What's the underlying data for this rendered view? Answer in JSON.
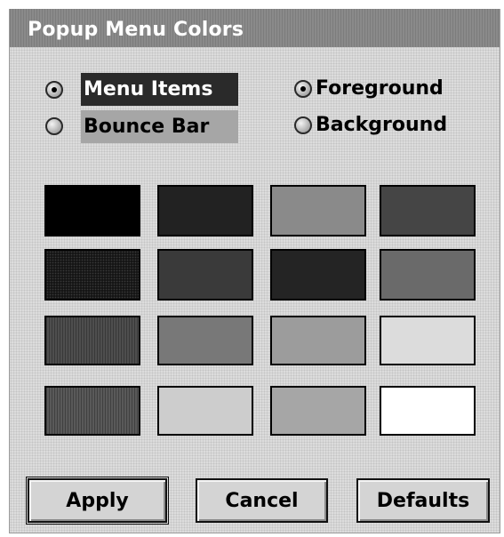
{
  "window": {
    "title": "Popup Menu Colors"
  },
  "target": {
    "items": [
      {
        "label": "Menu Items",
        "checked": true
      },
      {
        "label": "Bounce Bar",
        "checked": false
      }
    ]
  },
  "layer": {
    "items": [
      {
        "label": "Foreground",
        "checked": true
      },
      {
        "label": "Background",
        "checked": false
      }
    ]
  },
  "palette": {
    "colors": [
      "#000000",
      "#222222",
      "#8a8a8a",
      "#454545",
      "#151515",
      "#3a3a3a",
      "#242424",
      "#6a6a6a",
      "#4e4e4e",
      "#787878",
      "#9c9c9c",
      "#dcdcdc",
      "#595959",
      "#cdcdcd",
      "#a6a6a6",
      "#ffffff"
    ]
  },
  "buttons": {
    "apply": "Apply",
    "cancel": "Cancel",
    "defaults": "Defaults"
  }
}
